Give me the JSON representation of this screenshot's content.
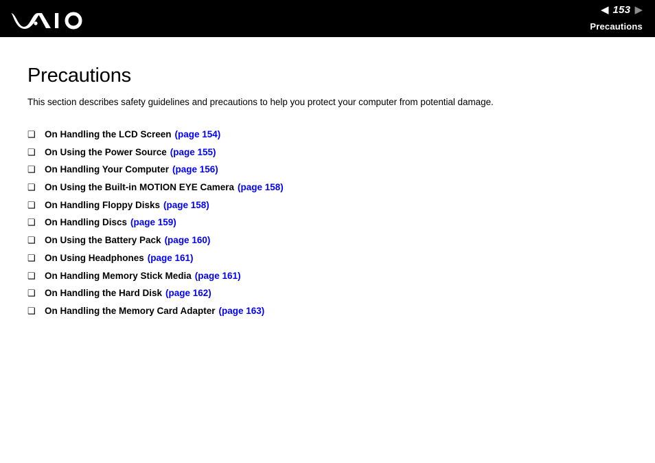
{
  "header": {
    "logo_name": "vaio-logo",
    "prev_arrow": "◀",
    "next_arrow": "▶",
    "page_number": "153",
    "section_label": "Precautions",
    "text_color": "#ffffff",
    "background_color": "#000000",
    "next_arrow_color": "#8a8a8a"
  },
  "main": {
    "title": "Precautions",
    "intro": "This section describes safety guidelines and precautions to help you protect your computer from potential damage.",
    "bullet_glyph": "❑",
    "link_color": "#0000ff",
    "toc": [
      {
        "label": "On Handling the LCD Screen",
        "page_ref": "(page 154)"
      },
      {
        "label": "On Using the Power Source",
        "page_ref": "(page 155)"
      },
      {
        "label": "On Handling Your Computer",
        "page_ref": "(page 156)"
      },
      {
        "label": "On Using the Built-in MOTION EYE Camera",
        "page_ref": "(page 158)"
      },
      {
        "label": "On Handling Floppy Disks",
        "page_ref": "(page 158)"
      },
      {
        "label": "On Handling Discs",
        "page_ref": "(page 159)"
      },
      {
        "label": "On Using the Battery Pack",
        "page_ref": "(page 160)"
      },
      {
        "label": "On Using Headphones",
        "page_ref": "(page 161)"
      },
      {
        "label": "On Handling Memory Stick Media",
        "page_ref": "(page 161)"
      },
      {
        "label": "On Handling the Hard Disk",
        "page_ref": "(page 162)"
      },
      {
        "label": "On Handling the Memory Card Adapter",
        "page_ref": "(page 163)"
      }
    ]
  }
}
